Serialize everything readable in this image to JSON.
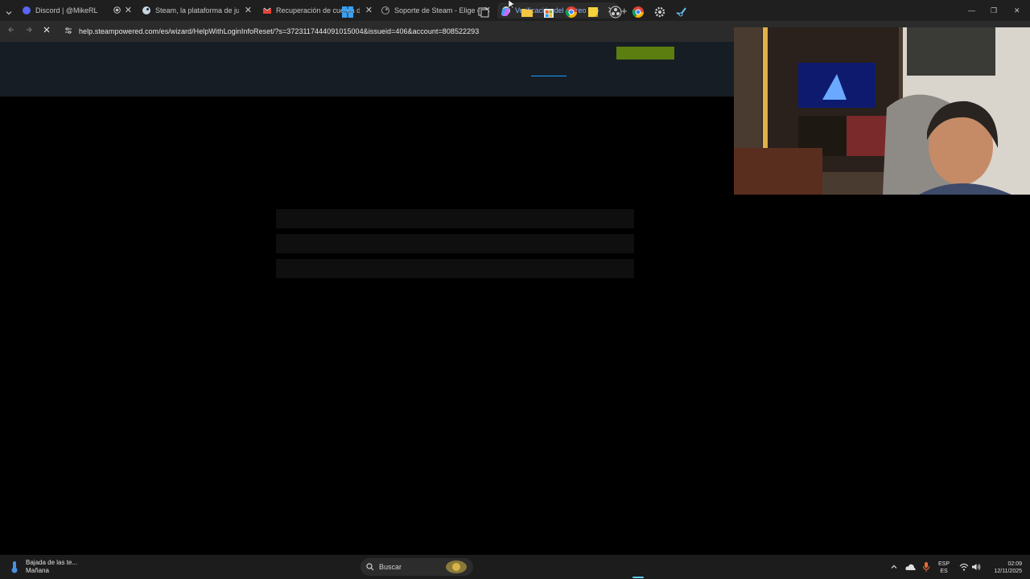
{
  "browser": {
    "tabs": [
      {
        "title": "Discord | @MikeRL",
        "icon": "discord-icon"
      },
      {
        "title": "Steam, la plataforma de juegos",
        "icon": "steam-icon"
      },
      {
        "title": "Recuperación de cuenta de Ste",
        "icon": "gmail-icon"
      },
      {
        "title": "Soporte de Steam - Elige qué",
        "icon": "steam-icon"
      },
      {
        "title": "Verificación del correo electrón",
        "icon": "steam-icon"
      }
    ],
    "new_tab": "+",
    "window_controls": {
      "minimize": "—",
      "maximize": "❐",
      "close": "✕"
    },
    "url": "help.steampowered.com/es/wizard/HelpWithLoginInfoReset/?s=3723117444091015004&issueid=406&account=808522293"
  },
  "page": {
    "accent_button_color": "#5c7e10",
    "header_color": "#171d25",
    "nav_underline_color": "#1a9fff"
  },
  "taskbar": {
    "weather_line1": "Bajada de las te...",
    "weather_line2": "Mañana",
    "search_placeholder": "Buscar",
    "lang_line1": "ESP",
    "lang_line2": "ES",
    "time": "02:09",
    "date": "12/11/2025"
  }
}
